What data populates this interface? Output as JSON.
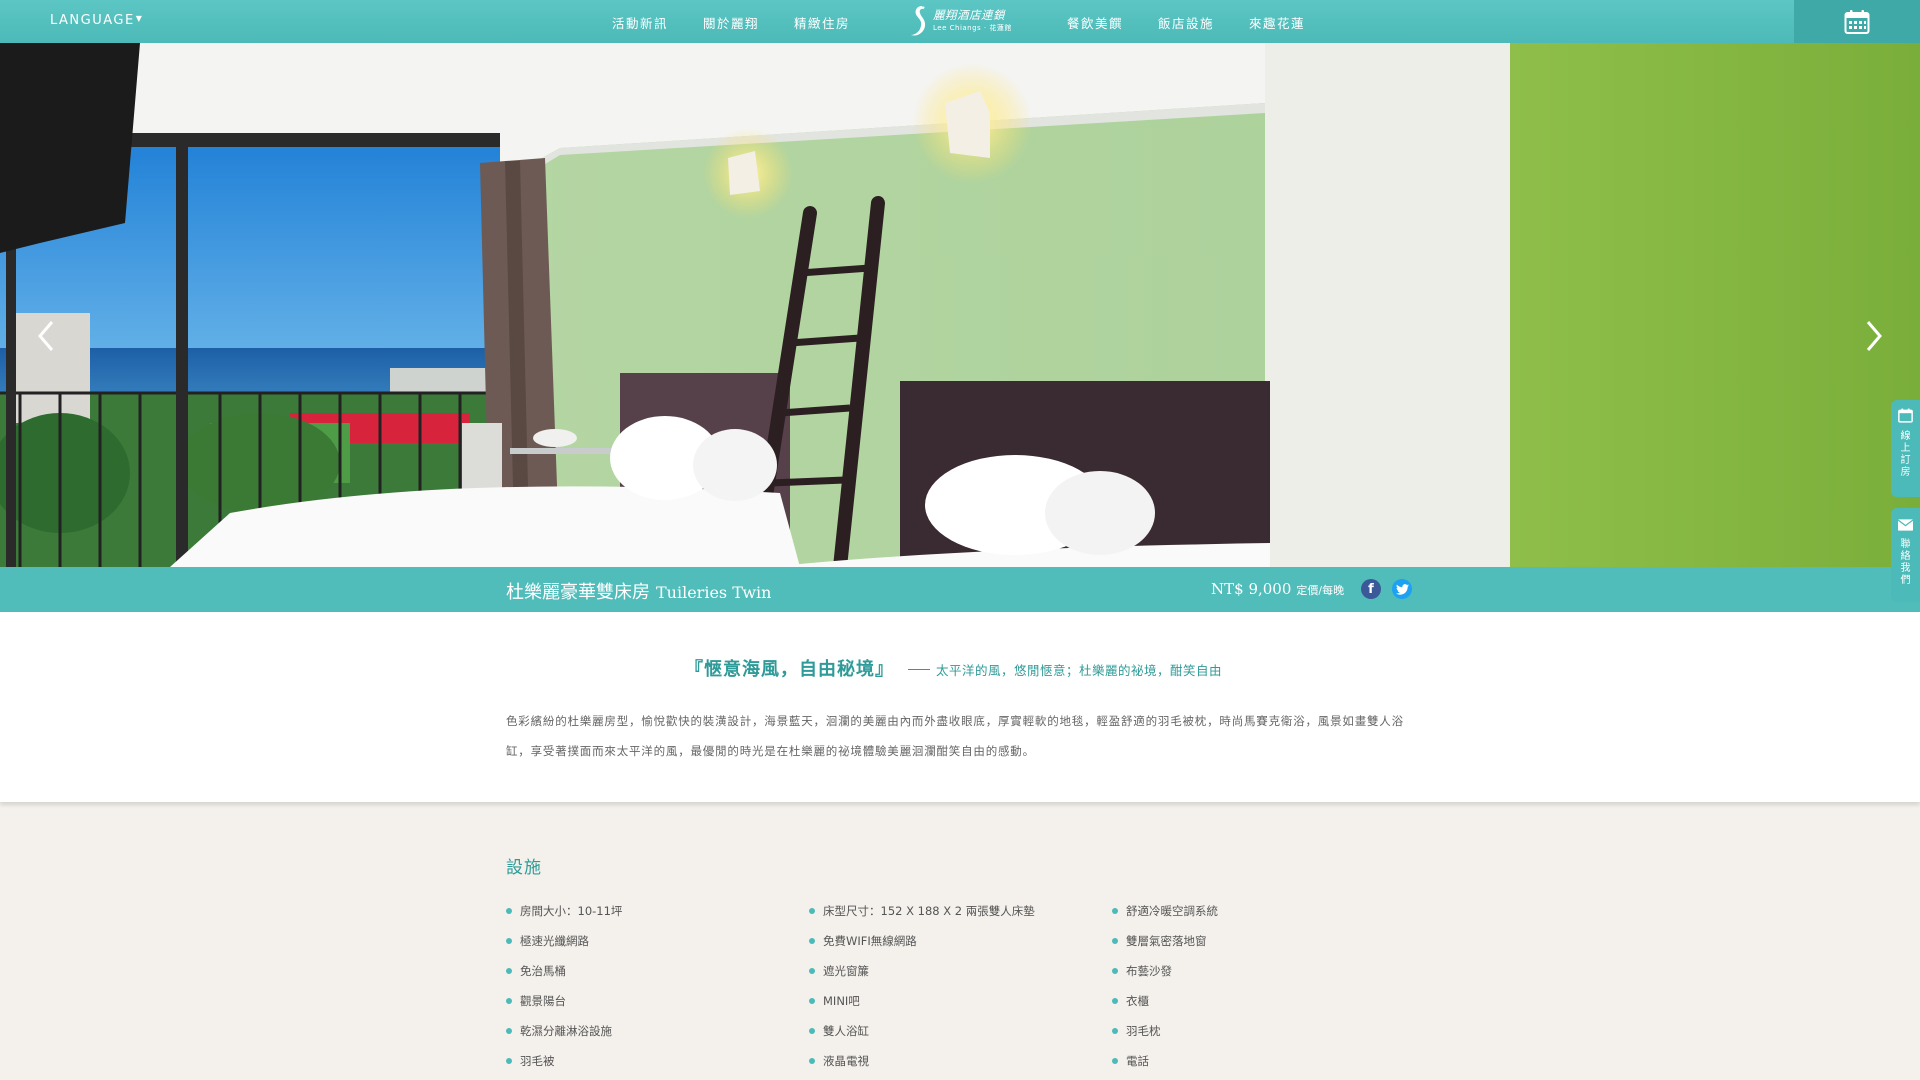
{
  "nav": {
    "language": "LANGUAGE",
    "links_left": [
      "活動新訊",
      "關於麗翔",
      "精緻住房"
    ],
    "links_right": [
      "餐飲美饌",
      "飯店設施",
      "來趣花蓮"
    ],
    "logo_line1": "麗翔酒店連鎖",
    "logo_line2": "Lee Chiangs · 花蓮館",
    "calendar_icon": "calendar-icon"
  },
  "hero": {
    "prev_icon": "chevron-left-icon",
    "next_icon": "chevron-right-icon"
  },
  "room": {
    "name_zh": "杜樂麗豪華雙床房",
    "name_en": "Tuileries  Twin",
    "price": "NT$ 9,000",
    "price_unit": "定價/每晚",
    "facebook": "f",
    "twitter": "t"
  },
  "intro": {
    "headline": "『愜意海風，自由秘境』",
    "subline": "太平洋的風，悠閒愜意；杜樂麗的祕境，酣笑自由",
    "description": "色彩繽紛的杜樂麗房型，愉悅歡快的裝潢設計，海景藍天，洄瀾的美麗由內而外盡收眼底，厚實輕軟的地毯，輕盈舒適的羽毛被枕，時尚馬賽克衛浴，風景如畫雙人浴缸，享受著撲面而來太平洋的風，最優閒的時光是在杜樂麗的祕境體驗美麗洄瀾酣笑自由的感動。"
  },
  "facilities": {
    "title": "設施",
    "columns": [
      [
        "房間大小：10-11坪",
        "極速光纖網路",
        "免治馬桶",
        "觀景陽台",
        "乾濕分離淋浴設施",
        "羽毛被"
      ],
      [
        "床型尺寸：152 X 188 X 2 兩張雙人床墊",
        "免費WIFI無線網路",
        "遮光窗簾",
        "MINI吧",
        "雙人浴缸",
        "液晶電視"
      ],
      [
        "舒適冷暖空調系統",
        "雙層氣密落地窗",
        "布藝沙發",
        "衣櫃",
        "羽毛枕",
        "電話"
      ]
    ]
  },
  "side_tabs": {
    "booking": "線上訂房",
    "contact": "聯絡我們"
  },
  "colors": {
    "teal": "#4cbab8",
    "teal_dark": "#2f9b98",
    "cream": "#f4f1ec"
  }
}
